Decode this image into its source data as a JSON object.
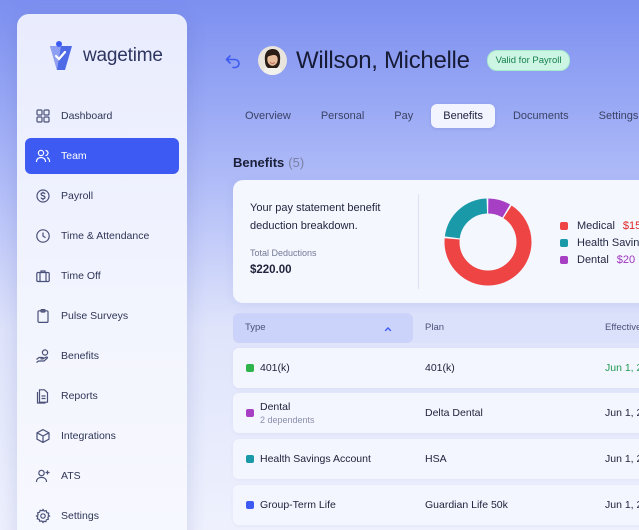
{
  "app": {
    "brand": "wagetime"
  },
  "sidebar": {
    "items": [
      {
        "label": "Dashboard",
        "icon": "dashboard-icon",
        "active": false
      },
      {
        "label": "Team",
        "icon": "team-icon",
        "active": true
      },
      {
        "label": "Payroll",
        "icon": "payroll-icon",
        "active": false
      },
      {
        "label": "Time & Attendance",
        "icon": "clock-icon",
        "active": false
      },
      {
        "label": "Time Off",
        "icon": "suitcase-icon",
        "active": false
      },
      {
        "label": "Pulse Surveys",
        "icon": "clipboard-icon",
        "active": false
      },
      {
        "label": "Benefits",
        "icon": "hand-coin-icon",
        "active": false
      },
      {
        "label": "Reports",
        "icon": "report-icon",
        "active": false
      },
      {
        "label": "Integrations",
        "icon": "cube-icon",
        "active": false
      },
      {
        "label": "ATS",
        "icon": "add-user-icon",
        "active": false
      },
      {
        "label": "Settings",
        "icon": "gear-icon",
        "active": false
      }
    ]
  },
  "header": {
    "name": "Willson, Michelle",
    "status": "Valid for Payroll"
  },
  "tabs": [
    {
      "label": "Overview",
      "active": false
    },
    {
      "label": "Personal",
      "active": false
    },
    {
      "label": "Pay",
      "active": false
    },
    {
      "label": "Benefits",
      "active": true
    },
    {
      "label": "Documents",
      "active": false
    },
    {
      "label": "Settings",
      "active": false
    }
  ],
  "benefits": {
    "title": "Benefits",
    "count": "(5)",
    "summary_text": "Your pay statement benefit deduction breakdown.",
    "total_label": "Total Deductions",
    "total_value": "$220.00",
    "legend": [
      {
        "label": "Medical",
        "value": "$15",
        "color": "#ef4444",
        "value_color": "#dc2626",
        "share": 0.68
      },
      {
        "label": "Health Savings",
        "value": "",
        "color": "#1a9aa8",
        "value_color": "#1a9aa8",
        "share": 0.23
      },
      {
        "label": "Dental",
        "value": "$20",
        "color": "#a63fc4",
        "value_color": "#9b34bd",
        "share": 0.09
      }
    ]
  },
  "table": {
    "columns": [
      "Type",
      "Plan",
      "Effective"
    ],
    "rows": [
      {
        "type": "401(k)",
        "sub": "",
        "plan": "401(k)",
        "date": "Jun 1, 2",
        "color": "#2eb44b",
        "date_color": "#1f9b4f"
      },
      {
        "type": "Dental",
        "sub": "2 dependents",
        "plan": "Delta Dental",
        "date": "Jun 1, 2",
        "color": "#a63fc4",
        "date_color": "#20243c"
      },
      {
        "type": "Health Savings Account",
        "sub": "",
        "plan": "HSA",
        "date": "Jun 1, 2",
        "color": "#1a9aa8",
        "date_color": "#20243c"
      },
      {
        "type": "Group-Term Life",
        "sub": "",
        "plan": "Guardian Life 50k",
        "date": "Jun 1, 2",
        "color": "#3d5bf2",
        "date_color": "#20243c"
      }
    ]
  }
}
